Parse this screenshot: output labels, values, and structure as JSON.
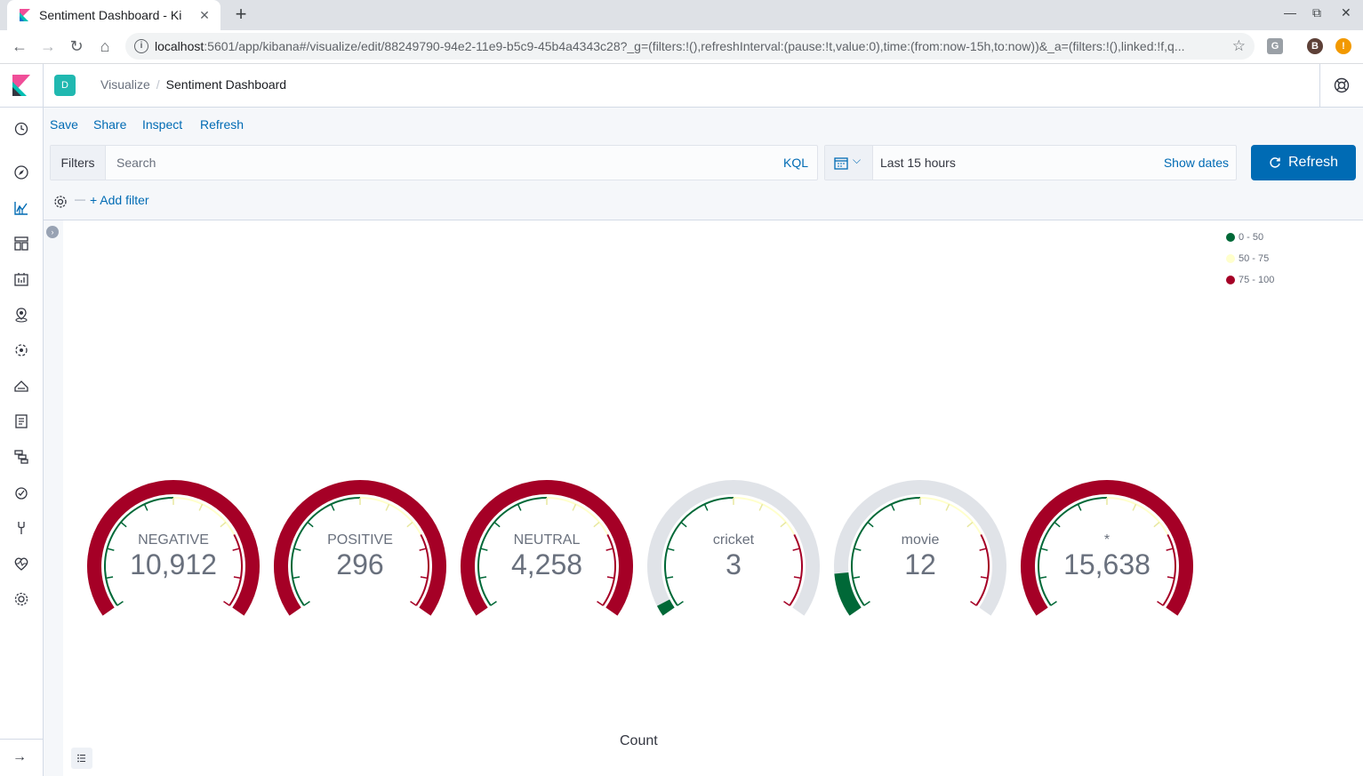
{
  "browser": {
    "tab_title": "Sentiment Dashboard - Ki",
    "url_host": "localhost",
    "url_rest": ":5601/app/kibana#/visualize/edit/88249790-94e2-11e9-b5c9-45b4a4343c28?_g=(filters:!(),refreshInterval:(pause:!t,value:0),time:(from:now-15h,to:now))&_a=(filters:!(),linked:!f,q...",
    "profile_initial": "B",
    "ext_initial": "G",
    "alert": "!"
  },
  "header": {
    "space_initial": "D",
    "breadcrumb_parent": "Visualize",
    "breadcrumb_current": "Sentiment Dashboard"
  },
  "menu": {
    "save": "Save",
    "share": "Share",
    "inspect": "Inspect",
    "refresh": "Refresh"
  },
  "query": {
    "filters_label": "Filters",
    "search_placeholder": "Search",
    "language": "KQL",
    "time_range": "Last 15 hours",
    "show_dates": "Show dates",
    "refresh_button": "Refresh",
    "add_filter": "+ Add filter"
  },
  "legend": [
    {
      "label": "0 - 50",
      "color": "#006837"
    },
    {
      "label": "50 - 75",
      "color": "#ffffcc"
    },
    {
      "label": "75 - 100",
      "color": "#a50026"
    }
  ],
  "gauges": [
    {
      "label": "NEGATIVE",
      "value": 10912,
      "display": "10,912"
    },
    {
      "label": "POSITIVE",
      "value": 296,
      "display": "296"
    },
    {
      "label": "NEUTRAL",
      "value": 4258,
      "display": "4,258"
    },
    {
      "label": "cricket",
      "value": 3,
      "display": "3"
    },
    {
      "label": "movie",
      "value": 12,
      "display": "12"
    },
    {
      "label": "*",
      "value": 15638,
      "display": "15,638"
    }
  ],
  "gauge_range": [
    0,
    100
  ],
  "axis_title": "Count"
}
